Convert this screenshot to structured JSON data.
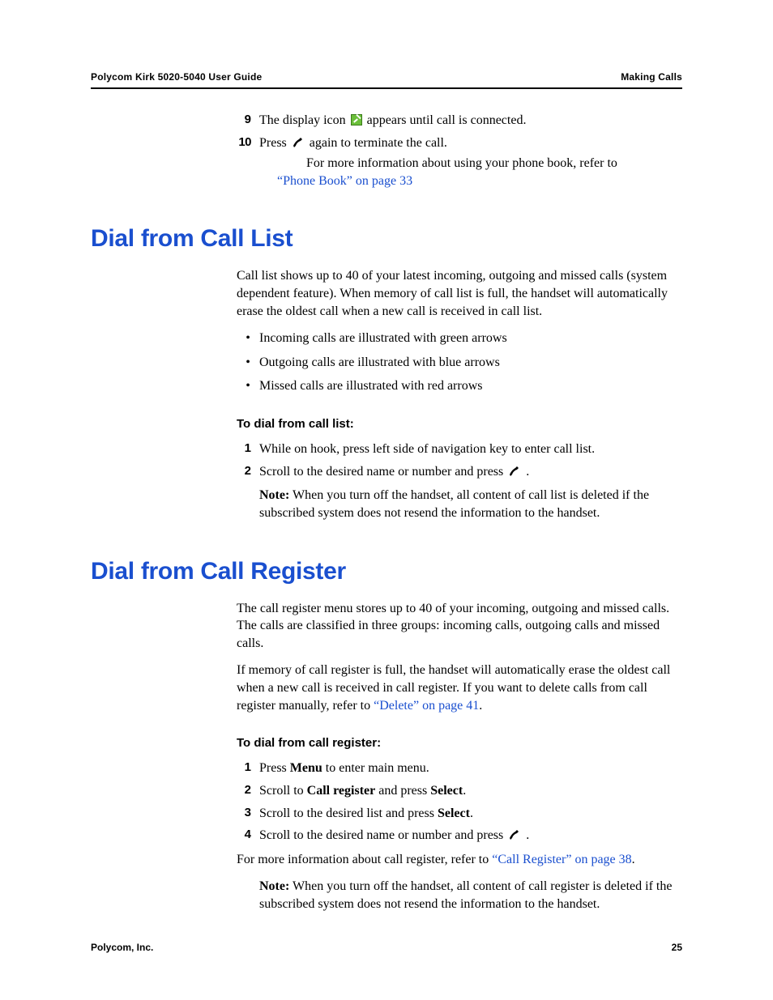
{
  "header": {
    "left": "Polycom Kirk 5020-5040 User Guide",
    "right": "Making Calls"
  },
  "top_steps": {
    "s9": {
      "num": "9",
      "t1": "The display icon ",
      "t2": " appears until call is connected."
    },
    "s10": {
      "num": "10",
      "t1": "Press ",
      "t2": " again to terminate the call.",
      "sub1": "For more information about using your phone book, refer to ",
      "link": "“Phone Book” on page 33"
    }
  },
  "section1": {
    "title": "Dial from Call List",
    "intro": "Call list shows up to 40 of your latest incoming, outgoing and missed calls (system dependent feature). When memory of call list is full, the handset will automatically erase the oldest call when a new call is received in call list.",
    "bullets": [
      "Incoming calls are illustrated with green arrows",
      "Outgoing calls are illustrated with blue arrows",
      "Missed calls are illustrated with red arrows"
    ],
    "subhead": "To dial from call list:",
    "step1": {
      "num": "1",
      "t": "While on hook, press left side of navigation key to enter call list."
    },
    "step2": {
      "num": "2",
      "t1": "Scroll to the desired name or number and press ",
      "t2": " ."
    },
    "note_label": "Note:",
    "note_text": " When you turn off the handset, all content of call list is deleted if the subscribed system does not resend the information to the handset."
  },
  "section2": {
    "title": "Dial from Call Register",
    "p1": "The call register menu stores up to 40 of your incoming, outgoing and missed calls. The calls are classified in three groups: incoming calls, outgoing calls and missed calls.",
    "p2a": "If memory of call register is full, the handset will automatically erase the oldest call when a new call is received in call register. If you want to delete calls from call register manually, refer to ",
    "p2link": "“Delete” on page 41",
    "p2b": ".",
    "subhead": "To dial from call register:",
    "step1": {
      "num": "1",
      "t1": "Press ",
      "b1": "Menu",
      "t2": " to enter main menu."
    },
    "step2": {
      "num": "2",
      "t1": "Scroll to ",
      "b1": "Call register",
      "t2": " and press ",
      "b2": "Select",
      "t3": "."
    },
    "step3": {
      "num": "3",
      "t1": "Scroll to the desired list and press ",
      "b1": "Select",
      "t2": "."
    },
    "step4": {
      "num": "4",
      "t1": "Scroll to the desired name or number and press ",
      "t2": " ."
    },
    "more_t1": "For more information about call register, refer to ",
    "more_link": "“Call Register” on page 38",
    "more_t2": ".",
    "note_label": "Note:",
    "note_text": " When you turn off the handset, all content of call register is deleted if the subscribed system does not resend the information to the handset."
  },
  "footer": {
    "left": "Polycom, Inc.",
    "right": "25"
  }
}
